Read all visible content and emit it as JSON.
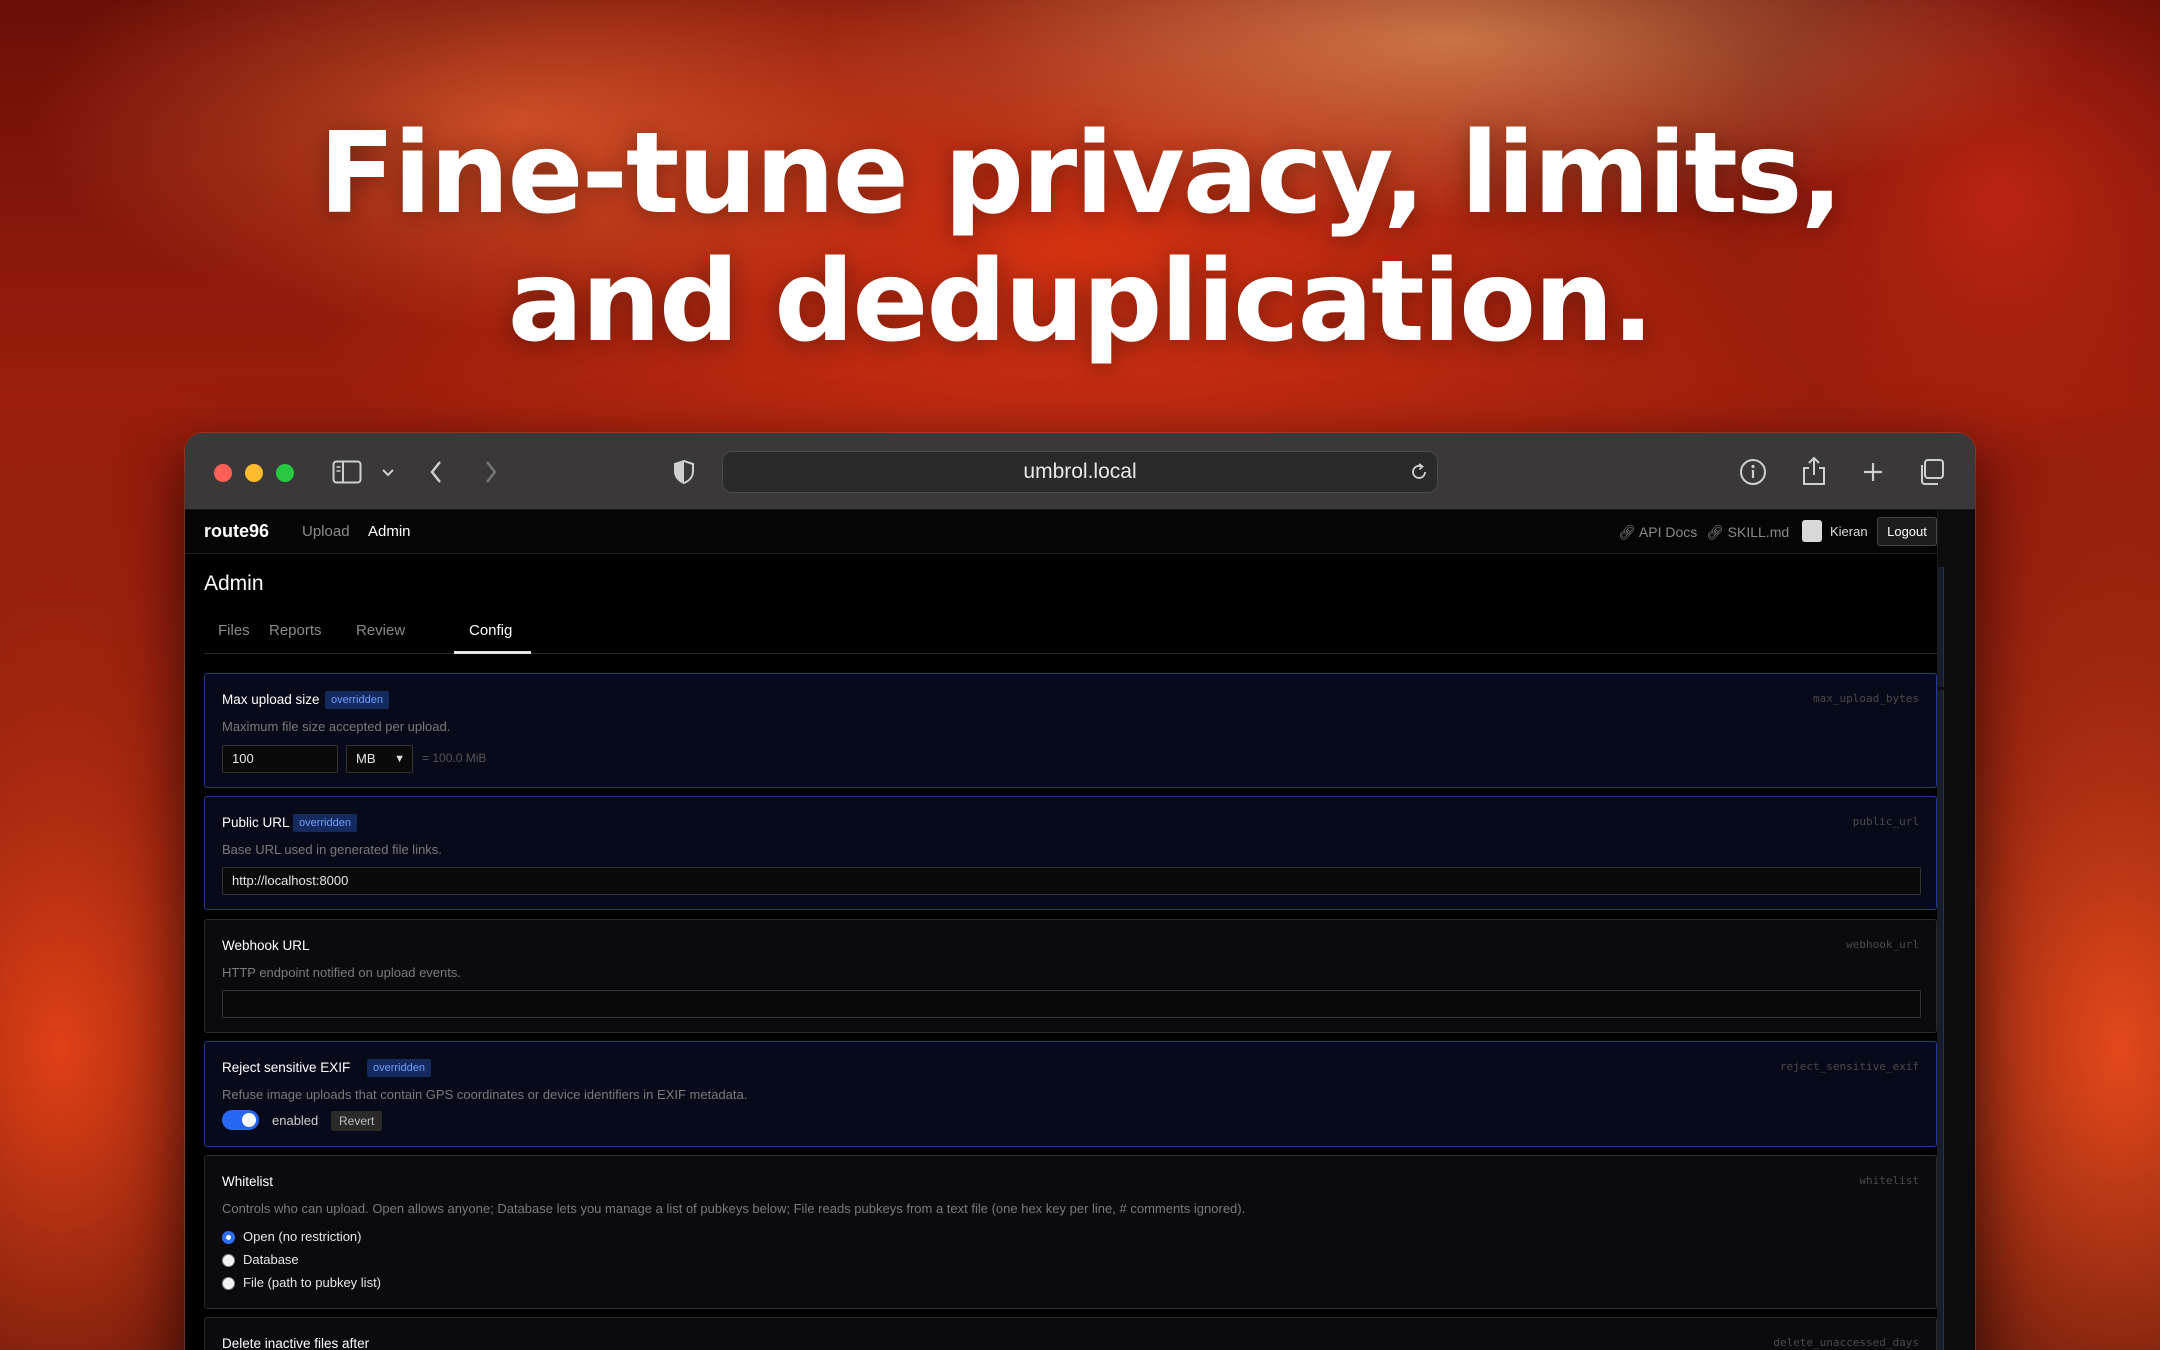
{
  "headline": {
    "line1": "Fine-tune privacy, limits,",
    "line2": "and deduplication."
  },
  "browser": {
    "url": "umbrol.local",
    "icons": [
      "sidebar-icon",
      "chevron-down-icon",
      "back-icon",
      "forward-icon",
      "shield-icon",
      "reload-icon",
      "info-icon",
      "share-icon",
      "plus-icon",
      "tabs-icon"
    ]
  },
  "nav": {
    "brand": "route96",
    "links": [
      "Upload",
      "Admin"
    ],
    "api_docs": "API Docs",
    "skill": "SKILL.md",
    "user": "Kieran",
    "logout": "Logout"
  },
  "page": {
    "title": "Admin",
    "tabs": [
      "Files",
      "Reports",
      "Review",
      "Config"
    ],
    "active_tab": "Config"
  },
  "config": {
    "max_upload": {
      "title": "Max upload size",
      "badge": "overridden",
      "key": "max_upload_bytes",
      "desc": "Maximum file size accepted per upload.",
      "value": "100",
      "unit": "MB",
      "computed": "= 100.0 MiB"
    },
    "public_url": {
      "title": "Public URL",
      "badge": "overridden",
      "key": "public_url",
      "desc": "Base URL used in generated file links.",
      "value": "http://localhost:8000"
    },
    "webhook": {
      "title": "Webhook URL",
      "key": "webhook_url",
      "desc": "HTTP endpoint notified on upload events.",
      "value": ""
    },
    "exif": {
      "title": "Reject sensitive EXIF",
      "badge": "overridden",
      "key": "reject_sensitive_exif",
      "desc": "Refuse image uploads that contain GPS coordinates or device identifiers in EXIF metadata.",
      "state": "enabled",
      "revert": "Revert"
    },
    "whitelist": {
      "title": "Whitelist",
      "key": "whitelist",
      "desc": "Controls who can upload. Open allows anyone; Database lets you manage a list of pubkeys below; File reads pubkeys from a text file (one hex key per line, # comments ignored).",
      "options": [
        "Open (no restriction)",
        "Database",
        "File (path to pubkey list)"
      ],
      "selected": "Open (no restriction)"
    },
    "delete_inactive": {
      "title": "Delete inactive files after",
      "key": "delete_unaccessed_days"
    }
  },
  "colors": {
    "accent": "#2766f0",
    "badge_bg": "#142a5e",
    "badge_text": "#6f9dff",
    "overridden_border": "#233a8c"
  }
}
